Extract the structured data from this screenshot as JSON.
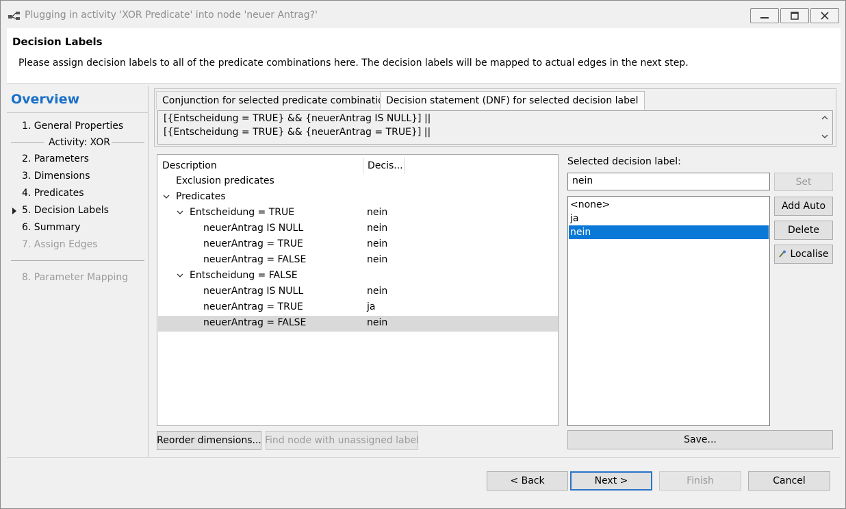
{
  "window": {
    "title": "Plugging in activity 'XOR Predicate' into node 'neuer Antrag?'"
  },
  "banner": {
    "title": "Decision Labels",
    "description": "Please assign decision labels to all of the predicate combinations here. The decision labels will be mapped to actual edges in the next step."
  },
  "nav": {
    "title": "Overview",
    "items": [
      {
        "label": "1.  General Properties",
        "enabled": true
      },
      {
        "label": "Activity: XOR",
        "enabled": true
      },
      {
        "label": "2.  Parameters",
        "enabled": true
      },
      {
        "label": "3.  Dimensions",
        "enabled": true
      },
      {
        "label": "4.  Predicates",
        "enabled": true
      },
      {
        "label": "5.  Decision Labels",
        "enabled": true,
        "current": true
      },
      {
        "label": "6.  Summary",
        "enabled": true
      },
      {
        "label": "7.  Assign Edges",
        "enabled": false
      },
      {
        "label": "8.  Parameter Mapping",
        "enabled": false
      }
    ]
  },
  "tabs": [
    {
      "label": "Conjunction for selected predicate combination",
      "active": false
    },
    {
      "label": "Decision statement (DNF) for selected decision label",
      "active": true
    }
  ],
  "dnf": {
    "lines": [
      "[{Entscheidung = TRUE} && {neuerAntrag IS NULL}] ||",
      "[{Entscheidung = TRUE} && {neuerAntrag = TRUE}] ||"
    ]
  },
  "tree": {
    "columns": [
      "Description",
      "Decis..."
    ],
    "rows": [
      {
        "desc": "Exclusion predicates",
        "val": "",
        "level": 0,
        "expander": false
      },
      {
        "desc": "Predicates",
        "val": "",
        "level": 0,
        "expander": true
      },
      {
        "desc": "Entscheidung = TRUE",
        "val": "nein",
        "level": 1,
        "expander": true
      },
      {
        "desc": "neuerAntrag IS NULL",
        "val": "nein",
        "level": 2,
        "expander": false
      },
      {
        "desc": "neuerAntrag = TRUE",
        "val": "nein",
        "level": 2,
        "expander": false
      },
      {
        "desc": "neuerAntrag = FALSE",
        "val": "nein",
        "level": 2,
        "expander": false
      },
      {
        "desc": "Entscheidung = FALSE",
        "val": "",
        "level": 1,
        "expander": true
      },
      {
        "desc": "neuerAntrag IS NULL",
        "val": "nein",
        "level": 2,
        "expander": false
      },
      {
        "desc": "neuerAntrag = TRUE",
        "val": "ja",
        "level": 2,
        "expander": false
      },
      {
        "desc": "neuerAntrag = FALSE",
        "val": "nein",
        "level": 2,
        "expander": false,
        "selected": true
      }
    ]
  },
  "tree_buttons": {
    "reorder": "Reorder dimensions...",
    "find_unassigned": "Find node with unassigned label"
  },
  "decision_panel": {
    "label": "Selected decision label:",
    "input_value": "nein",
    "options": [
      "<none>",
      "ja",
      "nein"
    ],
    "selected_option": "nein",
    "set": "Set",
    "add_auto": "Add Auto",
    "delete": "Delete",
    "localise": "Localise",
    "save": "Save..."
  },
  "footer": {
    "back": "< Back",
    "next": "Next >",
    "finish": "Finish",
    "cancel": "Cancel"
  }
}
